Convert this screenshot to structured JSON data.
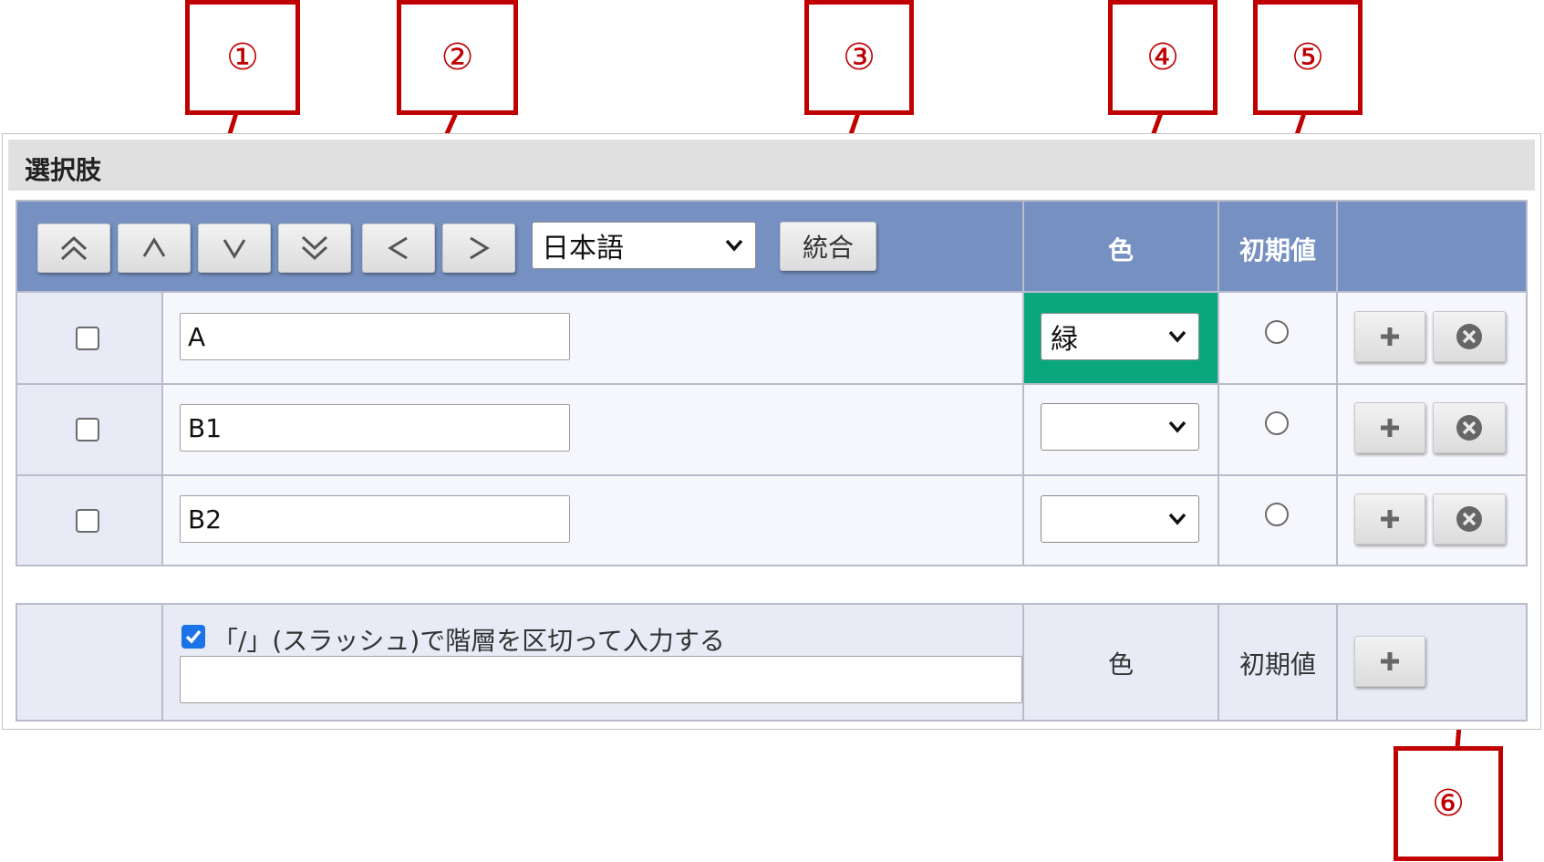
{
  "callouts": [
    "①",
    "②",
    "③",
    "④",
    "⑤",
    "⑥"
  ],
  "panel": {
    "title": "選択肢"
  },
  "toolbar": {
    "move_top_icon": "double-chevron-up-icon",
    "move_up_icon": "chevron-up-icon",
    "move_down_icon": "chevron-down-icon",
    "move_bottom_icon": "double-chevron-down-icon",
    "outdent_icon": "chevron-left-icon",
    "indent_icon": "chevron-right-icon",
    "language_select": "日本語",
    "merge_label": "統合"
  },
  "columns": {
    "color": "色",
    "default": "初期値"
  },
  "rows": [
    {
      "value": "A",
      "color": "緑",
      "color_hex": "#0aa77e"
    },
    {
      "value": "B1",
      "color": ""
    },
    {
      "value": "B2",
      "color": ""
    }
  ],
  "footer": {
    "hierarchy_label": "「/」(スラッシュ)で階層を区切って入力する",
    "hierarchy_checked": true,
    "new_value": "",
    "color_label": "色",
    "default_label": "初期値"
  },
  "colors": {
    "accent": "#c00000",
    "header": "#7590c1",
    "selected_green": "#0aa77e",
    "checkbox_blue": "#1a73e8"
  }
}
